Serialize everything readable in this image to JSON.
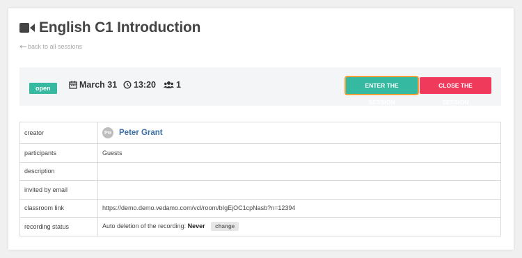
{
  "header": {
    "title": "English C1 Introduction",
    "title_icon": "video-camera-icon",
    "back_link": "back to all sessions"
  },
  "session": {
    "status": "open",
    "date": "March 31",
    "time": "13:20",
    "participants_count": "1",
    "enter_label": "ENTER THE SESSION",
    "close_label": "CLOSE THE SESSION"
  },
  "details": {
    "creator_label": "creator",
    "creator_initials": "PG",
    "creator_name": "Peter Grant",
    "participants_label": "participants",
    "participants_value": "Guests",
    "description_label": "description",
    "description_value": "",
    "invited_label": "invited by email",
    "invited_value": "",
    "classroom_label": "classroom link",
    "classroom_value": "https://demo.demo.vedamo.com/vcl/room/bIgEjOC1cpNasb?n=12394",
    "recording_label": "recording status",
    "recording_prefix": "Auto deletion of the recording:",
    "recording_value": "Never",
    "change_label": "change"
  },
  "colors": {
    "accent_green": "#36b9a1",
    "close_red": "#f03a5c",
    "focus_orange": "#f5a03a",
    "link_blue": "#3b6fa7"
  }
}
